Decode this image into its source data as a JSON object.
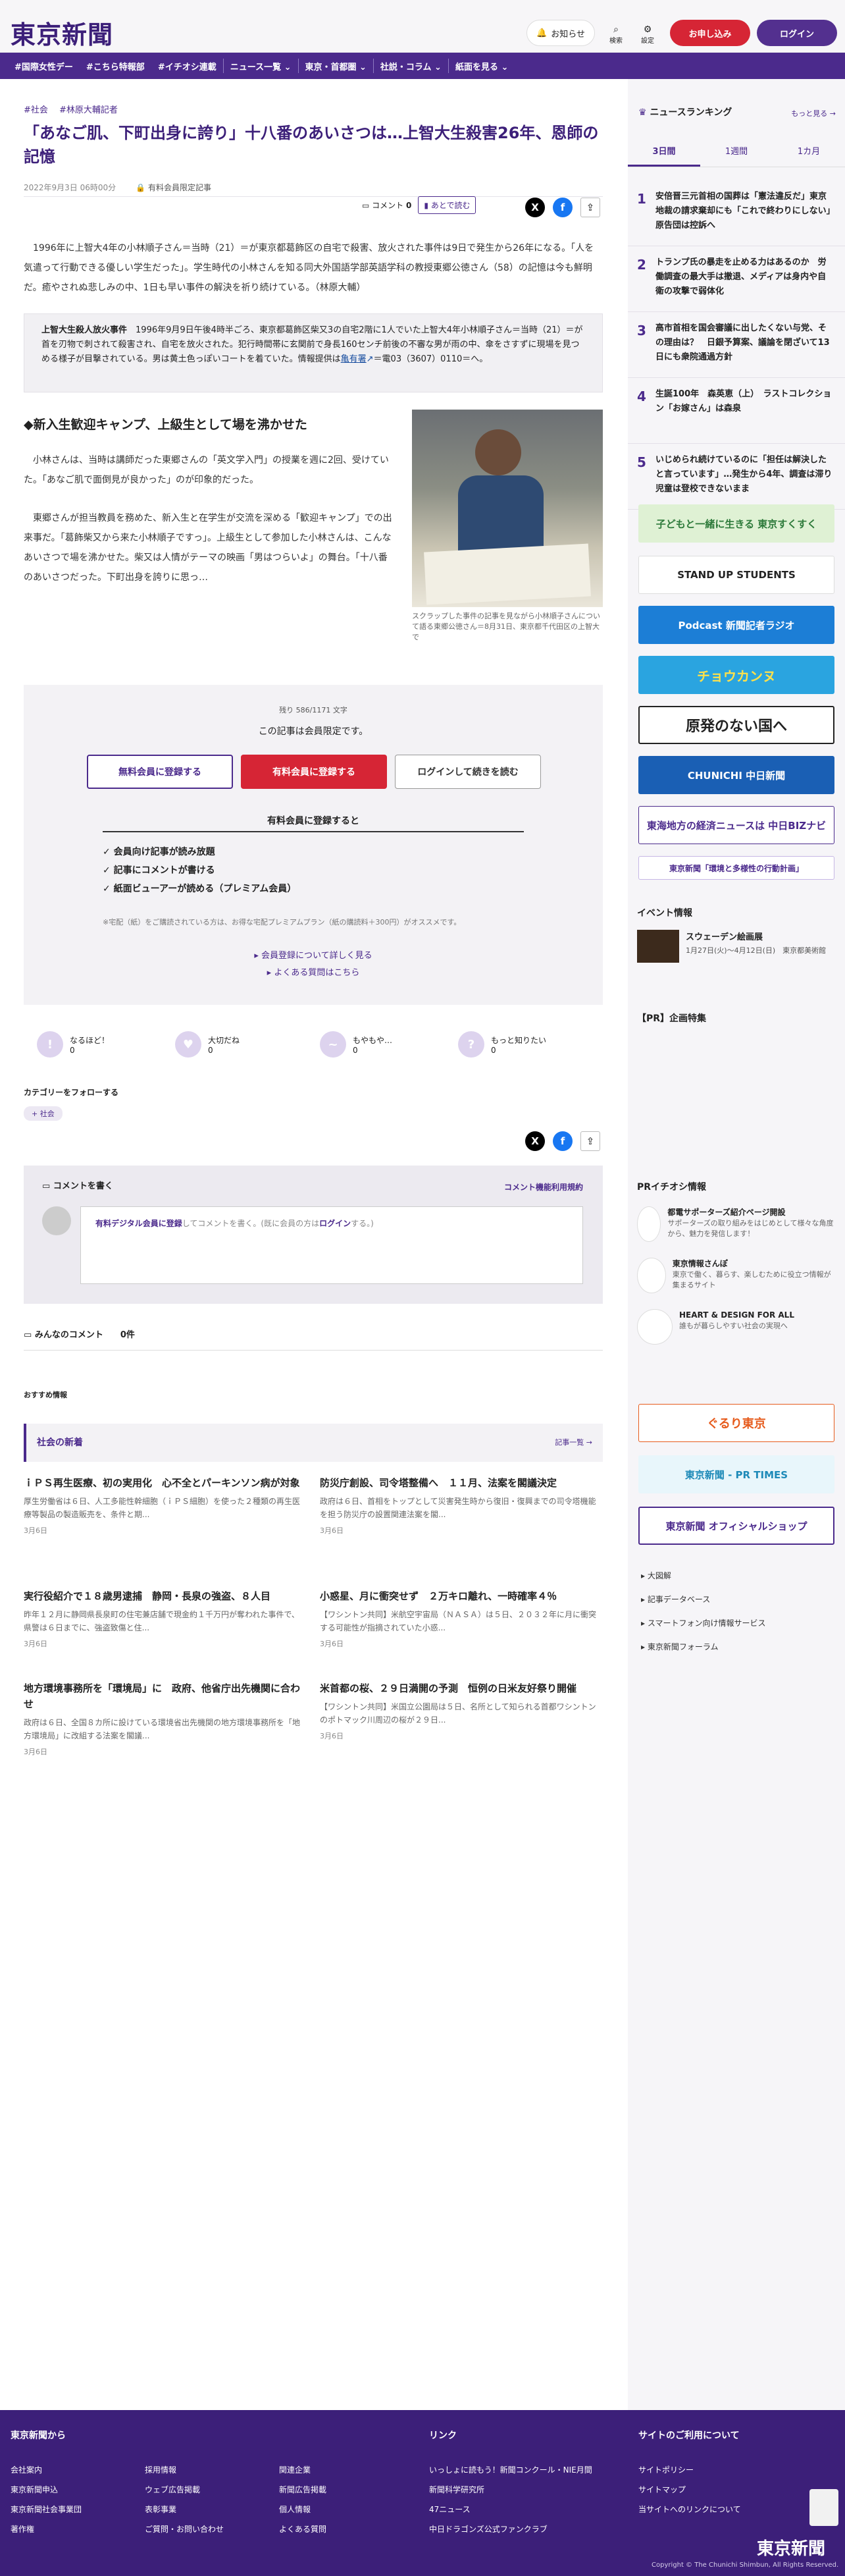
{
  "header": {
    "logo": "東京新聞",
    "notice": "お知らせ",
    "search": "検索",
    "settings": "設定",
    "apply": "お申し込み",
    "login": "ログイン"
  },
  "nav": [
    "#国際女性デー",
    "#こちら特報部",
    "#イチオシ連載",
    "ニュース一覧 ⌄",
    "東京・首都圏 ⌄",
    "社説・コラム ⌄",
    "紙面を見る ⌄"
  ],
  "article": {
    "tags": [
      "#社会",
      "#林原大輔記者"
    ],
    "title": "「あなご肌、下町出身に誇り」十八番のあいさつは…上智大生殺害26年、恩師の記憶",
    "date": "2022年9月3日 06時00分",
    "member_label": "有料会員限定記事",
    "comment_label": "コメント",
    "comment_count": "0",
    "later_label": "あとで読む",
    "lead": "1996年に上智大4年の小林順子さん＝当時（21）＝が東京都葛飾区の自宅で殺害、放火された事件は9日で発生から26年になる。「人を気遣って行動できる優しい学生だった」。学生時代の小林さんを知る同大外国語学部英語学科の教授東郷公徳さん（58）の記憶は今も鮮明だ。癒やされぬ悲しみの中、1日も早い事件の解決を祈り続けている。（林原大輔）",
    "box_title": "上智大生殺人放火事件",
    "box_text": "1996年9月9日午後4時半ごろ、東京都葛飾区柴又3の自宅2階に1人でいた上智大4年小林順子さん＝当時（21）＝が首を刃物で刺されて殺害され、自宅を放火された。犯行時間帯に玄関前で身長160センチ前後の不審な男が雨の中、傘をさすずに現場を見つめる様子が目撃されている。男は黄土色っぽいコートを着ていた。情報提供は",
    "box_link": "亀有署",
    "box_tel": "＝電03（3607）0110＝へ。",
    "h2": "◆新入生歓迎キャンプ、上級生として場を沸かせた",
    "para1": "小林さんは、当時は講師だった東郷さんの「英文学入門」の授業を週に2回、受けていた。「あなご肌で面倒見が良かった」のが印象的だった。",
    "para2": "東郷さんが担当教員を務めた、新入生と在学生が交流を深める「歓迎キャンプ」での出来事だ。「葛飾柴又から来た小林順子ですっ」。上級生として参加した小林さんは、こんなあいさつで場を沸かせた。柴又は人情がテーマの映画「男はつらいよ」の舞台。「十八番のあいさつだった。下町出身を誇りに思っ…",
    "photo_caption": "スクラップした事件の記事を見ながら小林順子さんについて語る東郷公徳さん＝8月31日、東京都千代田区の上智大で"
  },
  "paywall": {
    "remain": "残り 586/1171 文字",
    "limited": "この記事は会員限定です。",
    "free_btn": "無料会員に登録する",
    "paid_btn": "有料会員に登録する",
    "login_btn": "ログインして続きを読む",
    "benefit_title": "有料会員に登録すると",
    "benefits": [
      "✓ 会員向け記事が読み放題",
      "✓ 記事にコメントが書ける",
      "✓ 紙面ビューアーが読める（プレミアム会員）"
    ],
    "note": "※宅配（紙）をご購読されている方は、お得な宅配プレミアムプラン（紙の購読料＋300円）がオススメです。",
    "link1": "会員登録について詳しく見る",
    "link2": "よくある質問はこちら"
  },
  "reactions": [
    {
      "label": "なるほど！",
      "count": "0",
      "sym": "!"
    },
    {
      "label": "大切だね",
      "count": "0",
      "sym": "♥"
    },
    {
      "label": "もやもや…",
      "count": "0",
      "sym": "~"
    },
    {
      "label": "もっと知りたい",
      "count": "0",
      "sym": "?"
    }
  ],
  "follow": {
    "title": "カテゴリーをフォローする",
    "tag": "社会"
  },
  "comments": {
    "write": "コメントを書く",
    "policy": "コメント機能利用規約",
    "prompt_link": "有料デジタル会員に登録",
    "prompt_mid": "してコメントを書く。(既に会員の方は",
    "prompt_login": "ログイン",
    "prompt_end": "する。)",
    "all_label": "みんなのコメント",
    "all_count": "0件"
  },
  "recommend": {
    "label": "おすすめ情報",
    "section": "社会の新着",
    "more": "記事一覧"
  },
  "news": [
    {
      "t": "ｉＰＳ再生医療、初の実用化　心不全とパーキンソン病が対象",
      "d": "厚生労働省は６日、人工多能性幹細胞（ｉＰＳ細胞）を使った２種類の再生医療等製品の製造販売を、条件と期...",
      "dt": "3月6日"
    },
    {
      "t": "防災庁創設、司令塔整備へ　１１月、法案を閣議決定",
      "d": "政府は６日、首相をトップとして災害発生時から復旧・復興までの司令塔機能を担う防災庁の設置関連法案を閣...",
      "dt": "3月6日"
    },
    {
      "t": "実行役紹介で１８歳男逮捕　静岡・長泉の強盗、８人目",
      "d": "昨年１２月に静岡県長泉町の住宅兼店舗で現金約１千万円が奪われた事件で、県警は６日までに、強盗致傷と住...",
      "dt": "3月6日"
    },
    {
      "t": "小惑星、月に衝突せず　２万キロ離れ、一時確率４％",
      "d": "【ワシントン共同】米航空宇宙局（ＮＡＳＡ）は５日、２０３２年に月に衝突する可能性が指摘されていた小惑...",
      "dt": "3月6日"
    },
    {
      "t": "地方環境事務所を「環境局」に　政府、他省庁出先機関に合わせ",
      "d": "政府は６日、全国８カ所に設けている環境省出先機関の地方環境事務所を「地方環境局」に改組する法案を閣議...",
      "dt": "3月6日"
    },
    {
      "t": "米首都の桜、２９日満開の予測　恒例の日米友好祭り開催",
      "d": "【ワシントン共同】米国立公園局は５日、名所として知られる首都ワシントンのポトマック川周辺の桜が２９日...",
      "dt": "3月6日"
    }
  ],
  "ranking": {
    "title": "ニュースランキング",
    "more": "もっと見る",
    "tabs": [
      "3日間",
      "1週間",
      "1カ月"
    ],
    "items": [
      "安倍晋三元首相の国葬は「憲法違反だ」東京地裁の請求棄却にも「これで終わりにしない」原告団は控訴へ",
      "トランプ氏の暴走を止める力はあるのか　労働調査の最大手は撤退、メディアは身内や自衛の攻撃で弱体化",
      "高市首相を国会審議に出したくない与党、その理由は？　日銀予算案、議論を閉ざいて13日にも衆院通過方針",
      "生誕100年　森英恵（上）　ラストコレクション「お嫁さん」は森泉",
      "いじめられ続けているのに「担任は解決したと言っています」…発生から4年、調査は滞り児童は登校できないまま"
    ]
  },
  "banners": [
    "子どもと一緒に生きる 東京すくすく",
    "STAND UP STUDENTS",
    "Podcast 新聞記者ラジオ",
    "チョウカンヌ",
    "原発のない国へ",
    "CHUNICHI 中日新聞",
    "東海地方の経済ニュースは 中日BIZナビ",
    "東京新聞「環境と多様性の行動計画」"
  ],
  "event": {
    "title": "イベント情報",
    "name": "スウェーデン絵画展",
    "detail": "1月27日(火)～4月12日(日)　東京都美術館"
  },
  "pr_title": "【PR】企画特集",
  "pr_info": {
    "title": "PRイチオシ情報",
    "items": [
      {
        "t": "都電サポーターズ紹介ページ開設",
        "d": "サポーターズの取り組みをはじめとして様々な角度から、魅力を発信します！"
      },
      {
        "t": "東京情報さんぽ",
        "d": "東京で働く、暮らす、楽しむために役立つ情報が集まるサイト"
      },
      {
        "t": "HEART & DESIGN FOR ALL",
        "d": "誰もが暮らしやすい社会の実現へ"
      }
    ]
  },
  "side_banners2": [
    "ぐるり東京",
    "東京新聞 - PR TIMES",
    "東京新聞 オフィシャルショップ"
  ],
  "side_links": [
    "大図解",
    "記事データベース",
    "スマートフォン向け情報サービス",
    "東京新聞フォーラム"
  ],
  "footer": {
    "from": "東京新聞から",
    "links_title": "リンク",
    "about": "サイトのご利用について",
    "col1": [
      "会社案内",
      "東京新聞申込",
      "東京新聞社会事業団",
      "著作権"
    ],
    "col2": [
      "採用情報",
      "ウェブ広告掲載",
      "表彰事業",
      "ご質問・お問い合わせ"
    ],
    "col3": [
      "関連企業",
      "新聞広告掲載",
      "個人情報",
      "よくある質問"
    ],
    "col4": [
      "いっしょに読もう！新聞コンクール・NIE月間",
      "新聞科学研究所",
      "47ニュース",
      "中日ドラゴンズ公式ファンクラブ"
    ],
    "col5": [
      "サイトポリシー",
      "サイトマップ",
      "当サイトへのリンクについて"
    ],
    "logo": "東京新聞",
    "copyright": "Copyright © The Chunichi Shimbun, All Rights Reserved."
  }
}
